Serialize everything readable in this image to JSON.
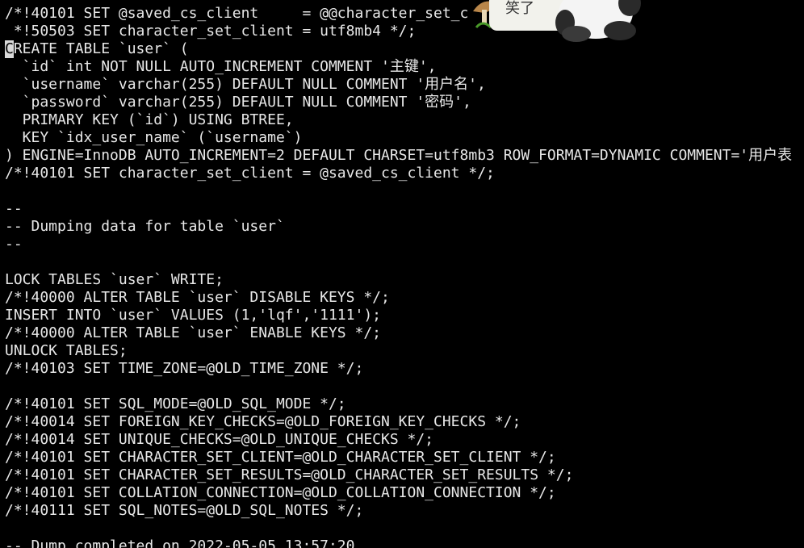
{
  "terminal": {
    "lines": [
      "/*!40101 SET @saved_cs_client     = @@character_set_c",
      " *!50503 SET character_set_client = utf8mb4 */;",
      "CREATE TABLE `user` (",
      "  `id` int NOT NULL AUTO_INCREMENT COMMENT '主键',",
      "  `username` varchar(255) DEFAULT NULL COMMENT '用户名',",
      "  `password` varchar(255) DEFAULT NULL COMMENT '密码',",
      "  PRIMARY KEY (`id`) USING BTREE,",
      "  KEY `idx_user_name` (`username`)",
      ") ENGINE=InnoDB AUTO_INCREMENT=2 DEFAULT CHARSET=utf8mb3 ROW_FORMAT=DYNAMIC COMMENT='用户表",
      "/*!40101 SET character_set_client = @saved_cs_client */;",
      "",
      "--",
      "-- Dumping data for table `user`",
      "--",
      "",
      "LOCK TABLES `user` WRITE;",
      "/*!40000 ALTER TABLE `user` DISABLE KEYS */;",
      "INSERT INTO `user` VALUES (1,'lqf','1111');",
      "/*!40000 ALTER TABLE `user` ENABLE KEYS */;",
      "UNLOCK TABLES;",
      "/*!40103 SET TIME_ZONE=@OLD_TIME_ZONE */;",
      "",
      "/*!40101 SET SQL_MODE=@OLD_SQL_MODE */;",
      "/*!40014 SET FOREIGN_KEY_CHECKS=@OLD_FOREIGN_KEY_CHECKS */;",
      "/*!40014 SET UNIQUE_CHECKS=@OLD_UNIQUE_CHECKS */;",
      "/*!40101 SET CHARACTER_SET_CLIENT=@OLD_CHARACTER_SET_CLIENT */;",
      "/*!40101 SET CHARACTER_SET_RESULTS=@OLD_CHARACTER_SET_RESULTS */;",
      "/*!40101 SET COLLATION_CONNECTION=@OLD_COLLATION_CONNECTION */;",
      "/*!40111 SET SQL_NOTES=@OLD_SQL_NOTES */;",
      "",
      "-- Dump completed on 2022-05-05 13:57:20"
    ]
  },
  "sticker": {
    "text": "笑了",
    "icon": "panda-sticker-icon"
  },
  "colors": {
    "background": "#000000",
    "text": "#e8e8e8"
  }
}
